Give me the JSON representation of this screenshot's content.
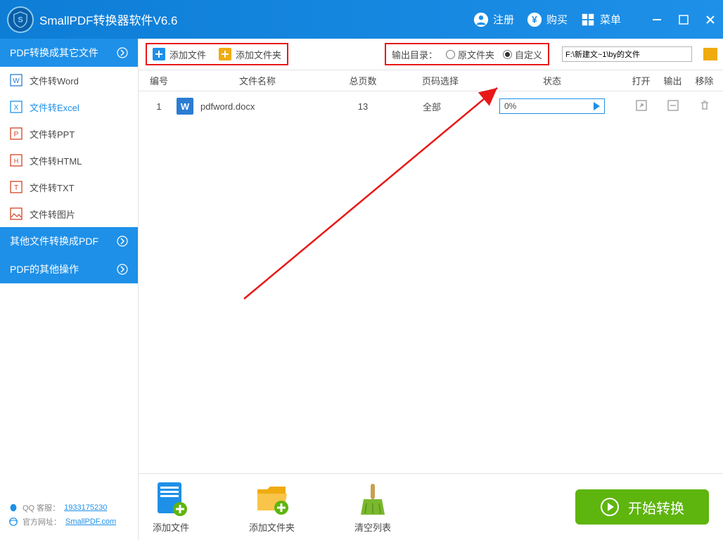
{
  "titlebar": {
    "title": "SmallPDF转换器软件V6.6",
    "register": "注册",
    "buy": "购买",
    "menu": "菜单"
  },
  "sidebar": {
    "headers": [
      "PDF转换成其它文件",
      "其他文件转换成PDF",
      "PDF的其他操作"
    ],
    "items": [
      {
        "label": "文件转Word"
      },
      {
        "label": "文件转Excel"
      },
      {
        "label": "文件转PPT"
      },
      {
        "label": "文件转HTML"
      },
      {
        "label": "文件转TXT"
      },
      {
        "label": "文件转图片"
      }
    ],
    "footer": {
      "qq_label": "QQ 客服：",
      "qq_num": "1933175230",
      "site_label": "官方网址：",
      "site_url": "SmallPDF.com"
    }
  },
  "toolbar": {
    "add_file": "添加文件",
    "add_folder": "添加文件夹",
    "output_label": "输出目录：",
    "radio_original": "原文件夹",
    "radio_custom": "自定义",
    "path_value": "F:\\新建文~1\\by的文件"
  },
  "table": {
    "headers": {
      "num": "编号",
      "name": "文件名称",
      "pages": "总页数",
      "range": "页码选择",
      "status": "状态",
      "open": "打开",
      "out": "输出",
      "del": "移除"
    },
    "rows": [
      {
        "num": "1",
        "file_letter": "W",
        "name": "pdfword.docx",
        "pages": "13",
        "range": "全部",
        "progress": "0%"
      }
    ]
  },
  "bottom": {
    "add_file": "添加文件",
    "add_folder": "添加文件夹",
    "clear": "清空列表",
    "convert": "开始转换"
  }
}
